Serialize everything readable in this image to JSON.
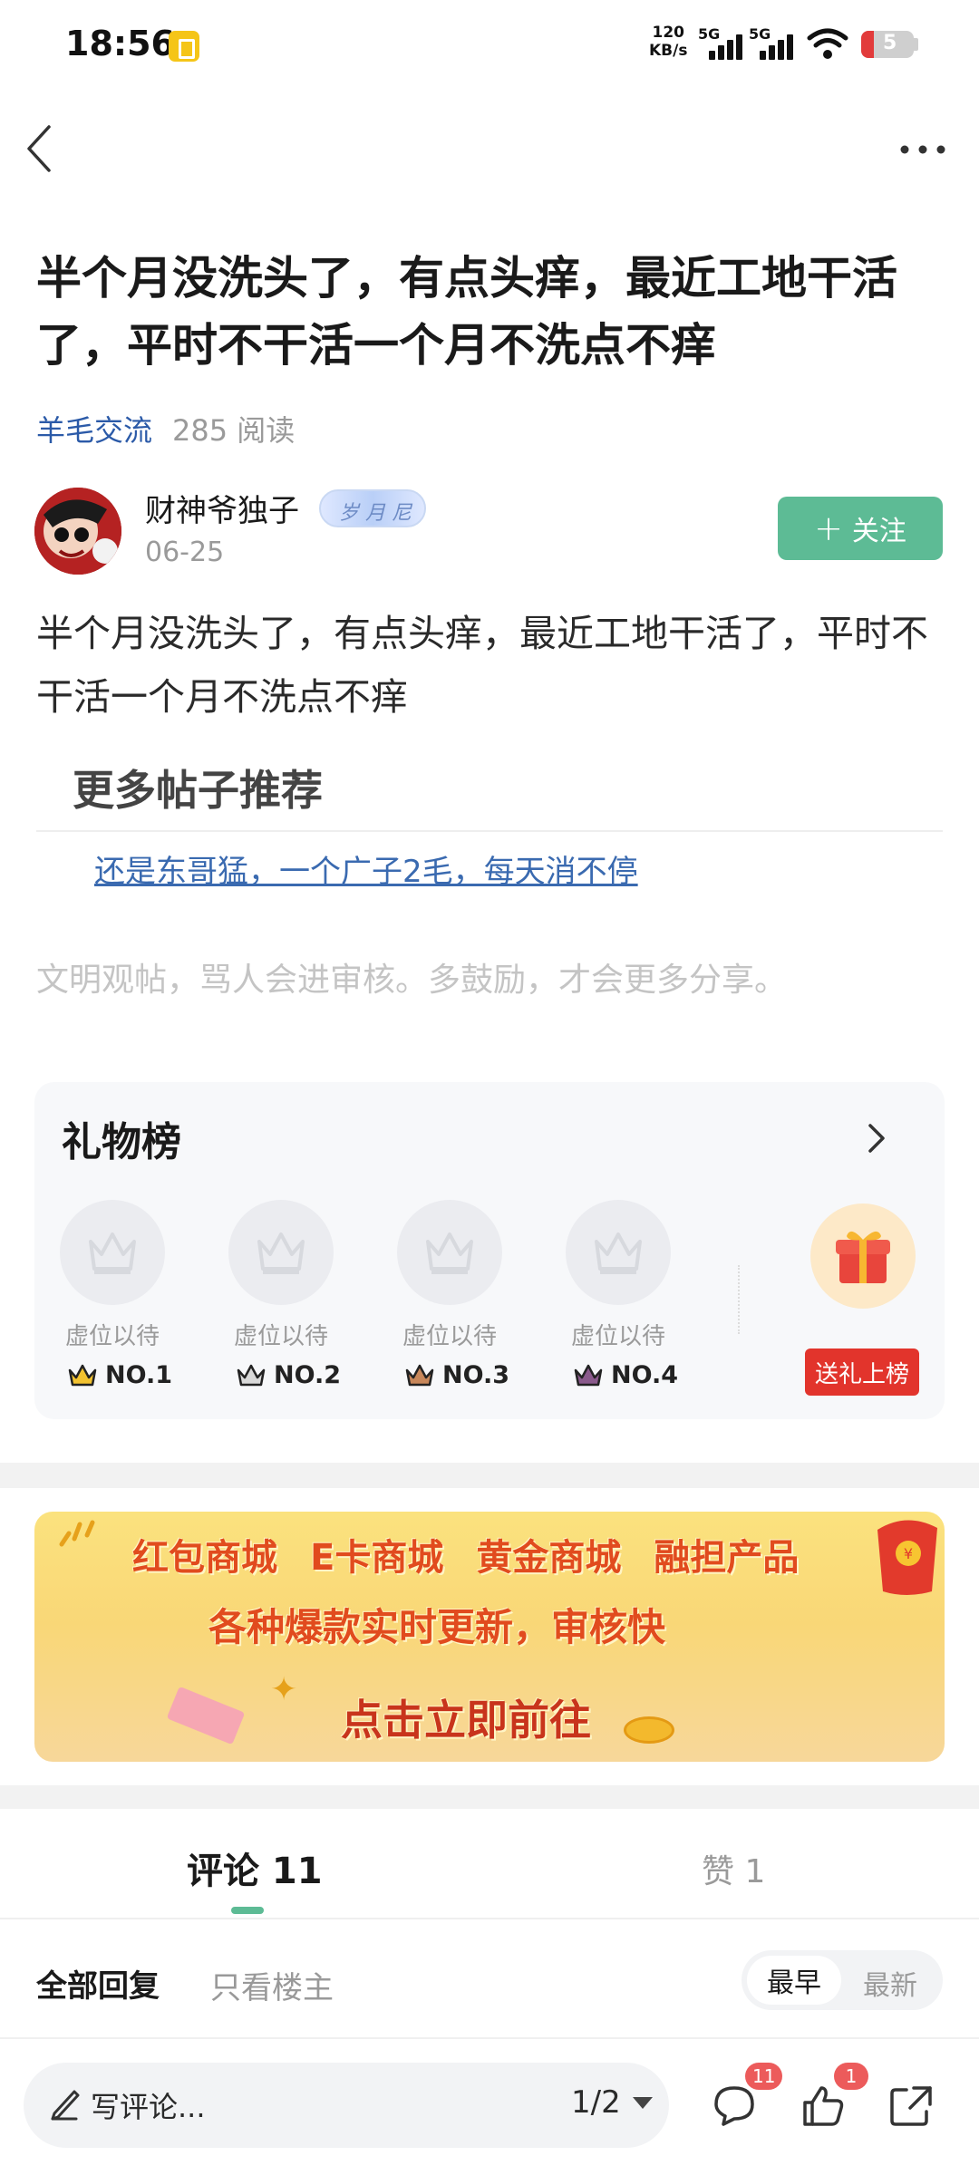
{
  "status_bar": {
    "time": "18:56",
    "net_speed_value": "120",
    "net_speed_unit": "KB/s",
    "signal1": "5G",
    "signal2": "5G",
    "battery": "5"
  },
  "post": {
    "title": "半个月没洗头了，有点头痒，最近工地干活了，平时不干活一个月不洗点不痒",
    "category": "羊毛交流",
    "read_count": "285 阅读",
    "author_name": "财神爷独子",
    "author_badge": "岁 月 尼",
    "date": "06-25",
    "follow_label": "关注",
    "body": "半个月没洗头了，有点头痒，最近工地干活了，平时不干活一个月不洗点不痒"
  },
  "more_posts": {
    "title": "更多帖子推荐",
    "link": "还是东哥猛，一个广子2毛，每天消不停"
  },
  "civility_note": "文明观帖，骂人会进审核。多鼓励，才会更多分享。",
  "gift_board": {
    "title": "礼物榜",
    "slots": [
      {
        "label": "虚位以待",
        "rank": "NO.1"
      },
      {
        "label": "虚位以待",
        "rank": "NO.2"
      },
      {
        "label": "虚位以待",
        "rank": "NO.3"
      },
      {
        "label": "虚位以待",
        "rank": "NO.4"
      }
    ],
    "send_label": "送礼上榜",
    "colors": {
      "rank1": "#f2c230",
      "rank2": "#d9d9d9",
      "rank3": "#c8875a",
      "rank4": "#8a5a8c"
    }
  },
  "banner": {
    "items": [
      "红包商城",
      "E卡商城",
      "黄金商城",
      "融担产品"
    ],
    "line2": "各种爆款实时更新，审核快",
    "cta": "点击立即前往"
  },
  "comments": {
    "tab_comments": "评论 11",
    "tab_likes": "赞 1",
    "filter_all": "全部回复",
    "filter_owner": "只看楼主",
    "sort_earliest": "最早",
    "sort_latest": "最新"
  },
  "bottom_bar": {
    "placeholder": "写评论...",
    "page": "1/2",
    "comment_count": "11",
    "like_count": "1"
  },
  "colors": {
    "accent": "#5dbb95",
    "link": "#2b5aa8",
    "badge_red": "#ec5b5b"
  }
}
